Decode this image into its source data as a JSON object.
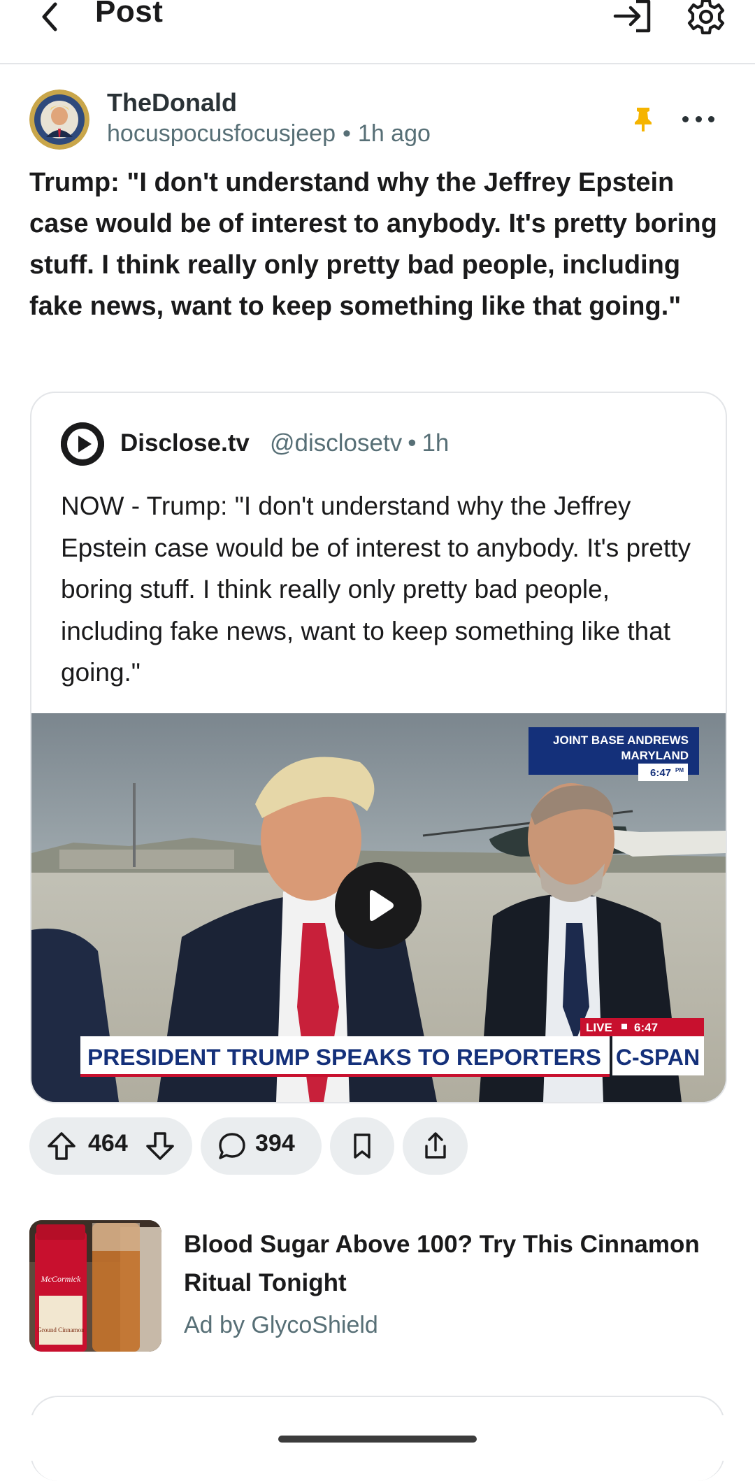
{
  "header": {
    "title": "Post",
    "back_icon": "chevron-left-icon",
    "login_icon": "login-arrow-icon",
    "settings_icon": "gear-icon"
  },
  "post": {
    "community": "TheDonald",
    "author": "hocuspocusfocusjeep",
    "separator": "•",
    "age": "1h ago",
    "pin_color": "#f5b400",
    "title": "Trump: \"I don't understand why the Jeffrey Epstein case would be of interest to anybody. It's pretty boring stuff. I think really only pretty bad people, including fake news, want to keep something like that going.\""
  },
  "embed": {
    "author": "Disclose.tv",
    "handle": "@disclosetv",
    "separator": "•",
    "age": "1h",
    "text": "NOW - Trump: \"I don't understand why the Jeffrey Epstein case would be of interest to anybody. It's pretty boring stuff. I think really only pretty bad people, including fake news, want to keep something like that going.\"",
    "video": {
      "location_line1": "JOINT BASE ANDREWS",
      "location_line2": "MARYLAND",
      "time_tag": "6:47",
      "time_suffix": "PM",
      "live_label": "LIVE",
      "live_time": "6:47",
      "chyron": "PRESIDENT TRUMP SPEAKS TO REPORTERS",
      "network": "C-SPAN"
    }
  },
  "actions": {
    "upvote_count": "464",
    "comment_count": "394"
  },
  "ad": {
    "title": "Blood Sugar Above 100? Try This Cinnamon Ritual Tonight",
    "by": "Ad by GlycoShield",
    "jar_brand": "McCormick",
    "jar_label": "Ground Cinnamon"
  }
}
